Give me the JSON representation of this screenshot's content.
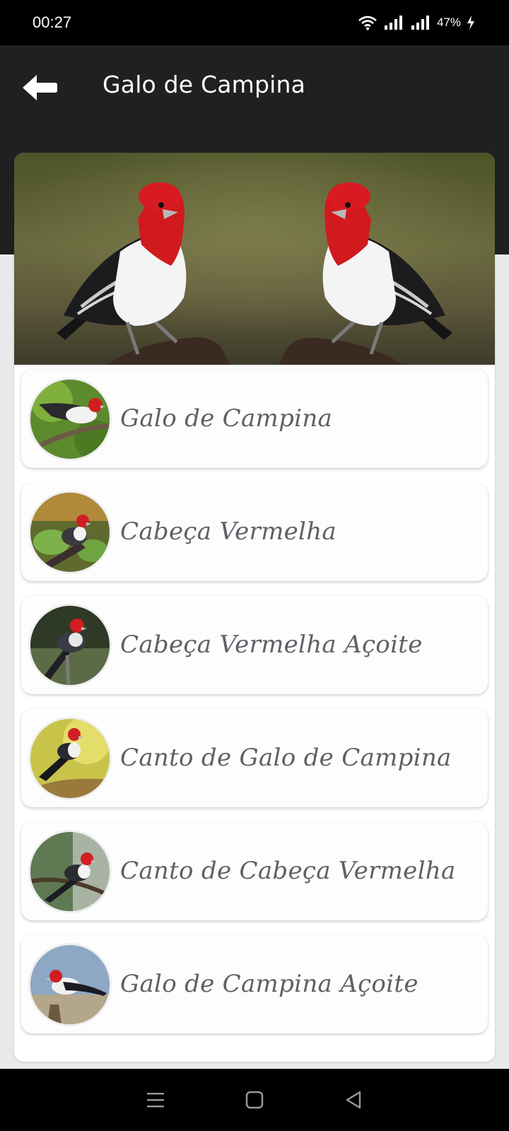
{
  "status_bar": {
    "time": "00:27",
    "battery": "47%",
    "icons": [
      "wifi-icon",
      "signal-icon",
      "signal-icon",
      "charging-icon"
    ]
  },
  "app_bar": {
    "title": "Galo de Campina",
    "back_icon": "arrow-left-icon",
    "background": "#202022"
  },
  "hero": {
    "description_icon": "red-cowled-cardinal-pair-image"
  },
  "list": {
    "items": [
      {
        "label": "Galo de Campina",
        "icon": "bird-thumbnail"
      },
      {
        "label": "Cabeça Vermelha",
        "icon": "bird-thumbnail"
      },
      {
        "label": "Cabeça Vermelha Açoite",
        "icon": "bird-thumbnail"
      },
      {
        "label": "Canto de Galo de Campina",
        "icon": "bird-thumbnail"
      },
      {
        "label": "Canto de Cabeça Vermelha",
        "icon": "bird-thumbnail"
      },
      {
        "label": "Galo de Campina Açoite",
        "icon": "bird-thumbnail"
      }
    ]
  },
  "nav_bar": {
    "buttons": [
      "menu-icon",
      "home-icon",
      "back-triangle-icon"
    ]
  },
  "colors": {
    "label_text": "#5f5f66",
    "page_background": "#e9e9ec",
    "card_background": "#ffffff"
  }
}
